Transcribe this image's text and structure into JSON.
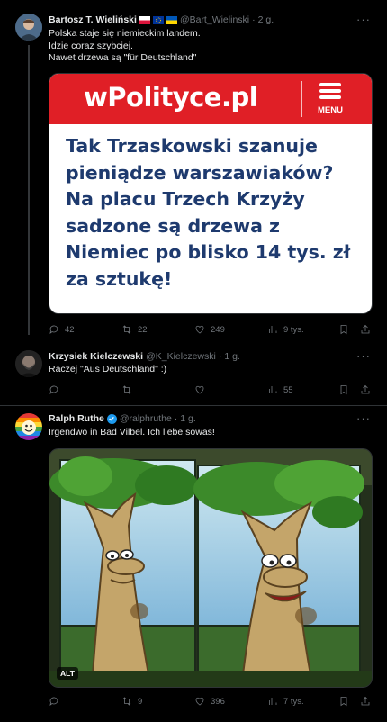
{
  "tweets": [
    {
      "name": "Bartosz T. Wieliński",
      "handle": "@Bart_Wielinski",
      "dot": "·",
      "time": "2 g.",
      "lines": [
        "Polska staje się niemieckim landem.",
        "Idzie coraz szybciej.",
        "Nawet drzewa są \"für Deutschland\""
      ],
      "card": {
        "brand": "wPolityce.pl",
        "menu_label": "MENU",
        "headline_lines": [
          "Tak Trzaskowski szanuje",
          "pieniądze warszawiaków?",
          "Na placu Trzech Krzyży",
          "sadzone są drzewa z",
          "Niemiec po blisko 14 tys. zł",
          "za sztukę!"
        ]
      },
      "replies": "42",
      "reposts": "22",
      "likes": "249",
      "views": "9 tys."
    },
    {
      "name": "Krzysiek Kielczewski",
      "handle": "@K_Kielczewski",
      "dot": "·",
      "time": "1 g.",
      "lines": [
        "Raczej \"Aus Deutschland\" :)"
      ],
      "replies": "",
      "reposts": "",
      "likes": "",
      "views": "55"
    },
    {
      "name": "Ralph Ruthe",
      "handle": "@ralphruthe",
      "dot": "·",
      "time": "1 g.",
      "lines": [
        "Irgendwo in Bad Vilbel. Ich liebe sowas!"
      ],
      "image_alt_badge": "ALT",
      "replies": "",
      "reposts": "9",
      "likes": "396",
      "views": "7 tys."
    }
  ],
  "colors": {
    "background": "#000000",
    "text": "#e7e9ea",
    "muted": "#71767b",
    "divider": "#2f3336",
    "brand_red": "#e01f26",
    "headline_blue": "#1e3a6e",
    "verified": "#1d9bf0"
  }
}
